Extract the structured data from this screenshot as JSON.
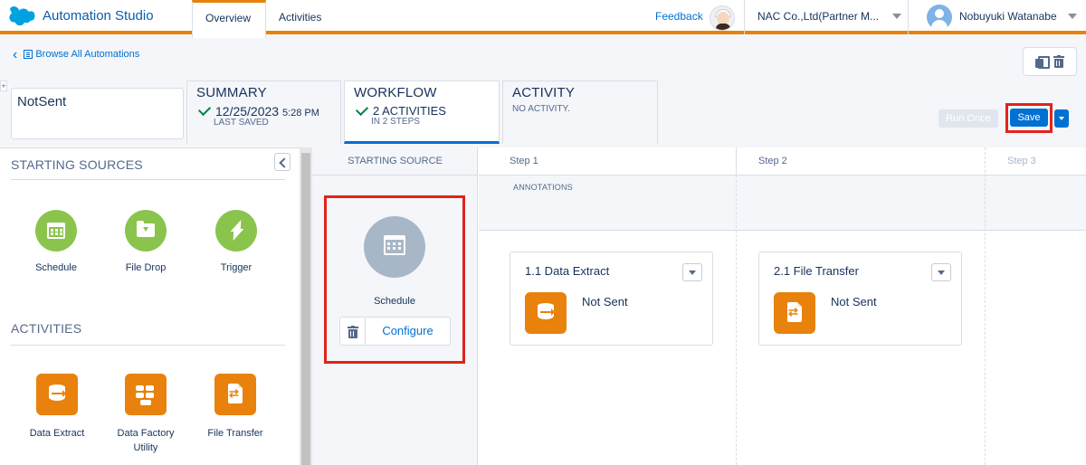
{
  "header": {
    "app_title": "Automation Studio",
    "tabs": [
      {
        "label": "Overview",
        "active": true
      },
      {
        "label": "Activities",
        "active": false
      }
    ],
    "feedback_label": "Feedback",
    "org_name": "NAC Co.,Ltd(Partner M...",
    "user_name": "Nobuyuki Watanabe"
  },
  "subheader": {
    "browse_label": "Browse All Automations",
    "automation_name": "NotSent",
    "summary": {
      "title": "SUMMARY",
      "date": "12/25/2023",
      "time": "5:28 PM",
      "caption": "LAST SAVED"
    },
    "workflow": {
      "title": "WORKFLOW",
      "value": "2 ACTIVITIES",
      "caption": "IN 2 STEPS"
    },
    "activity": {
      "title": "ACTIVITY",
      "value": "NO ACTIVITY."
    },
    "run_once_label": "Run Once",
    "save_label": "Save"
  },
  "left_panel": {
    "starting_sources_title": "STARTING SOURCES",
    "sources": [
      {
        "label": "Schedule",
        "icon": "calendar-icon"
      },
      {
        "label": "File Drop",
        "icon": "folder-download-icon"
      },
      {
        "label": "Trigger",
        "icon": "lightning-bolt-icon"
      }
    ],
    "activities_title": "ACTIVITIES",
    "activities": [
      {
        "label": "Data Extract",
        "icon": "data-extract-icon"
      },
      {
        "label": "Data Factory Utility",
        "icon": "data-factory-icon"
      },
      {
        "label": "File Transfer",
        "icon": "file-transfer-icon"
      }
    ]
  },
  "canvas": {
    "starting_source_header": "STARTING SOURCE",
    "steps": [
      "Step 1",
      "Step 2",
      "Step 3"
    ],
    "annotations_label": "ANNOTATIONS",
    "starting_source": {
      "label": "Schedule",
      "configure_label": "Configure"
    },
    "activity_cards": [
      {
        "title": "1.1 Data Extract",
        "status": "Not Sent",
        "icon": "data-extract-icon"
      },
      {
        "title": "2.1 File Transfer",
        "status": "Not Sent",
        "icon": "file-transfer-icon"
      }
    ]
  },
  "colors": {
    "accent_orange": "#e8820c",
    "brand_blue": "#0070d2",
    "source_green": "#8ac44d",
    "highlight_red": "#e2231a"
  }
}
